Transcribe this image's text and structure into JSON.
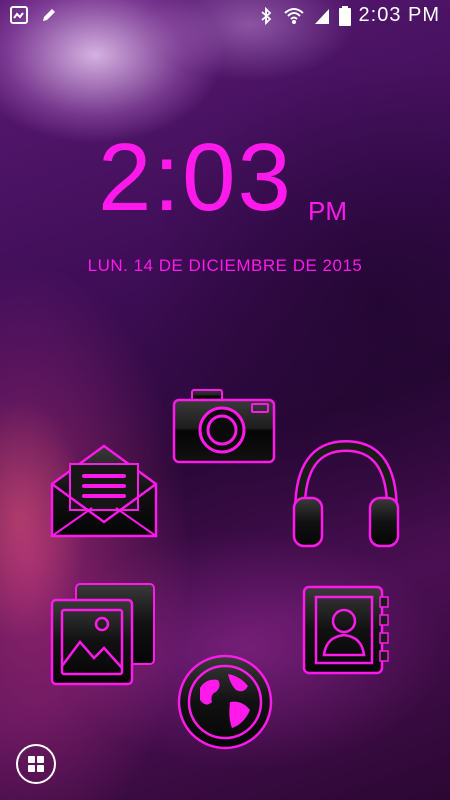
{
  "status_bar": {
    "left_icons": [
      "gallery-notification-icon",
      "edit-notification-icon"
    ],
    "right_icons": [
      "bluetooth-icon",
      "wifi-icon",
      "signal-icon",
      "battery-icon"
    ],
    "time": "2:03 PM"
  },
  "clock": {
    "time": "2:03",
    "ampm": "PM",
    "date": "LUN. 14 DE DICIEMBRE DE 2015"
  },
  "apps": [
    {
      "name": "camera",
      "icon": "camera-icon"
    },
    {
      "name": "email",
      "icon": "envelope-icon"
    },
    {
      "name": "music",
      "icon": "headphones-icon"
    },
    {
      "name": "gallery",
      "icon": "gallery-icon"
    },
    {
      "name": "contacts",
      "icon": "contacts-book-icon"
    },
    {
      "name": "browser",
      "icon": "globe-icon"
    }
  ],
  "dock": {
    "icon": "app-drawer-icon"
  },
  "colors": {
    "accent": "#ff19ea",
    "icon_fill": "#1a1a1a",
    "wallpaper_base": "#3d0d55"
  }
}
